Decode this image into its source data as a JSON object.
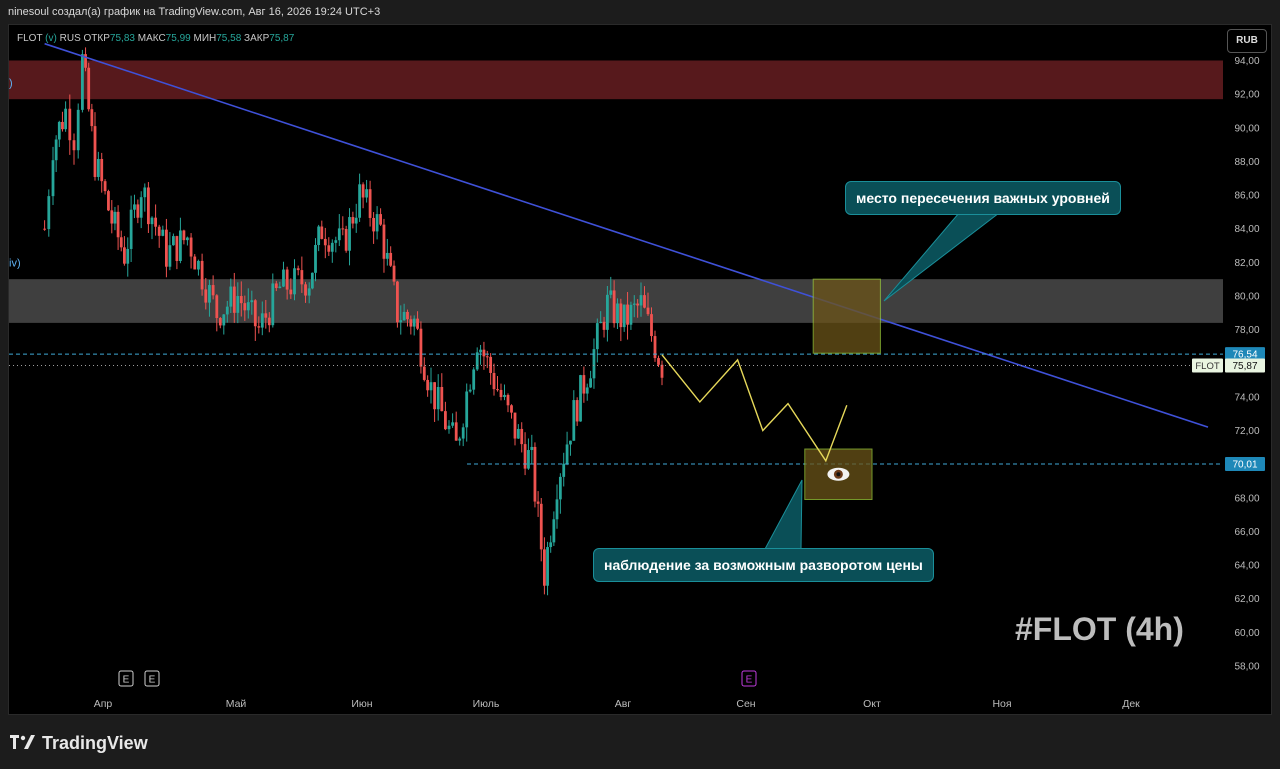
{
  "header": {
    "text": "ninesoul создал(а) график на TradingView.com, Авг 16, 2026 19:24 UTC+3"
  },
  "legend": {
    "symbol": "FLOT",
    "mark": "(v)",
    "exchange": "RUS",
    "open_label": "ОТКР",
    "open": "75,83",
    "high_label": "МАКС",
    "high": "75,99",
    "low_label": "МИН",
    "low": "75,58",
    "close_label": "ЗАКР",
    "close": "75,87"
  },
  "currency": "RUB",
  "edge_labels": [
    {
      "text": ")",
      "price": 92.7
    },
    {
      "text": "iv)",
      "price": 82.0
    }
  ],
  "callouts": {
    "top": "место пересечения важных уровней",
    "bottom": "наблюдение за возможным разворотом цены"
  },
  "watermark": "#FLOT (4h)",
  "eye_icon": "eye-icon",
  "event_badges": [
    "E",
    "E",
    "E"
  ],
  "footer": {
    "brand": "TradingView",
    "logo_icon": "tradingview-logo-icon"
  },
  "colors": {
    "up": "#26a69a",
    "down": "#ef5350",
    "trendline": "#3f51d8",
    "resistance_zone": "#5c1a1e",
    "support_zone": "#4a4a4a",
    "target_box": "#6b5418",
    "projection": "#e6d85a",
    "callout": "#0a4f57"
  },
  "chart_data": {
    "type": "candlestick",
    "price_axis": {
      "min": 57,
      "max": 95,
      "ticks": [
        "58,00",
        "60,00",
        "62,00",
        "64,00",
        "66,00",
        "68,00",
        "70,00",
        "72,00",
        "74,00",
        "76,00",
        "78,00",
        "80,00",
        "82,00",
        "84,00",
        "86,00",
        "88,00",
        "90,00",
        "92,00",
        "94,00"
      ]
    },
    "time_axis": {
      "labels": [
        "Апр",
        "Май",
        "Июн",
        "Июль",
        "Авг",
        "Сен",
        "Окт",
        "Ноя",
        "Дек"
      ]
    },
    "price_path": [
      {
        "date": "2026-03-20",
        "price": 84.0
      },
      {
        "date": "2026-03-22",
        "price": 89.0
      },
      {
        "date": "2026-03-25",
        "price": 91.0
      },
      {
        "date": "2026-03-27",
        "price": 89.5
      },
      {
        "date": "2026-03-29",
        "price": 94.0
      },
      {
        "date": "2026-04-01",
        "price": 88.0
      },
      {
        "date": "2026-04-05",
        "price": 84.5
      },
      {
        "date": "2026-04-08",
        "price": 82.5
      },
      {
        "date": "2026-04-12",
        "price": 86.5
      },
      {
        "date": "2026-04-18",
        "price": 82.5
      },
      {
        "date": "2026-04-23",
        "price": 83.5
      },
      {
        "date": "2026-04-30",
        "price": 79.0
      },
      {
        "date": "2026-05-05",
        "price": 80.0
      },
      {
        "date": "2026-05-10",
        "price": 78.0
      },
      {
        "date": "2026-05-15",
        "price": 80.5
      },
      {
        "date": "2026-05-22",
        "price": 81.0
      },
      {
        "date": "2026-05-25",
        "price": 84.0
      },
      {
        "date": "2026-05-30",
        "price": 83.0
      },
      {
        "date": "2026-06-03",
        "price": 86.0
      },
      {
        "date": "2026-06-08",
        "price": 84.0
      },
      {
        "date": "2026-06-12",
        "price": 79.0
      },
      {
        "date": "2026-06-16",
        "price": 78.5
      },
      {
        "date": "2026-06-20",
        "price": 74.5
      },
      {
        "date": "2026-06-26",
        "price": 71.0
      },
      {
        "date": "2026-07-01",
        "price": 77.5
      },
      {
        "date": "2026-07-05",
        "price": 75.0
      },
      {
        "date": "2026-07-10",
        "price": 72.0
      },
      {
        "date": "2026-07-14",
        "price": 70.0
      },
      {
        "date": "2026-07-17",
        "price": 63.5
      },
      {
        "date": "2026-07-20",
        "price": 69.0
      },
      {
        "date": "2026-07-24",
        "price": 73.0
      },
      {
        "date": "2026-07-28",
        "price": 76.0
      },
      {
        "date": "2026-08-01",
        "price": 79.5
      },
      {
        "date": "2026-08-05",
        "price": 78.5
      },
      {
        "date": "2026-08-09",
        "price": 79.5
      },
      {
        "date": "2026-08-14",
        "price": 75.87
      }
    ],
    "zones": [
      {
        "name": "resistance",
        "from": 91.7,
        "to": 94.0
      },
      {
        "name": "support-resistance",
        "from": 78.4,
        "to": 81.0
      }
    ],
    "trendline": [
      {
        "date": "2026-03-20",
        "price": 95.0
      },
      {
        "date": "2026-12-22",
        "price": 72.2
      }
    ],
    "levels": [
      {
        "price": 76.54,
        "label": "76,54",
        "style": "dashed",
        "color": "#3fa9d6"
      },
      {
        "price": 75.87,
        "label": "75,87",
        "tag": "FLOT",
        "style": "dotted",
        "color": "#9e9e9e"
      },
      {
        "price": 70.01,
        "label": "70,01",
        "style": "dashed",
        "color": "#3fa9d6"
      }
    ],
    "boxes": [
      {
        "name": "intersection-box",
        "date_from": "2026-09-19",
        "date_to": "2026-10-05",
        "price_from": 76.6,
        "price_to": 81.0
      },
      {
        "name": "reversal-box",
        "date_from": "2026-09-17",
        "date_to": "2026-10-03",
        "price_from": 67.9,
        "price_to": 70.9
      }
    ],
    "projection": [
      {
        "date": "2026-08-14",
        "price": 76.5
      },
      {
        "date": "2026-08-23",
        "price": 73.7
      },
      {
        "date": "2026-09-01",
        "price": 76.2
      },
      {
        "date": "2026-09-07",
        "price": 72.0
      },
      {
        "date": "2026-09-13",
        "price": 73.6
      },
      {
        "date": "2026-09-22",
        "price": 70.2
      },
      {
        "date": "2026-09-27",
        "price": 73.5
      }
    ]
  }
}
